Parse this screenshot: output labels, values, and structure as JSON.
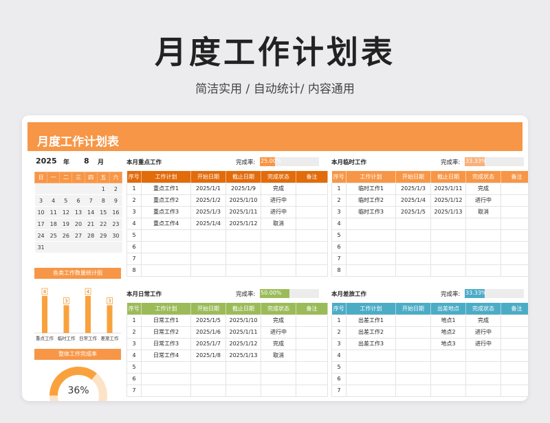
{
  "hero": {
    "title": "月度工作计划表",
    "subtitle": "简洁实用 / 自动统计/ 内容通用"
  },
  "banner": {
    "title": "月度工作计划表"
  },
  "date": {
    "year": "2025",
    "year_unit": "年",
    "month": "8",
    "month_unit": "月"
  },
  "calendar": {
    "weekdays": [
      "日",
      "一",
      "二",
      "三",
      "四",
      "五",
      "六"
    ],
    "weeks": [
      [
        "",
        "",
        "",
        "",
        "",
        "1",
        "2"
      ],
      [
        "3",
        "4",
        "5",
        "6",
        "7",
        "8",
        "9"
      ],
      [
        "10",
        "11",
        "12",
        "13",
        "14",
        "15",
        "16"
      ],
      [
        "17",
        "18",
        "19",
        "20",
        "21",
        "22",
        "23"
      ],
      [
        "24",
        "25",
        "26",
        "27",
        "28",
        "29",
        "30"
      ],
      [
        "31",
        "",
        "",
        "",
        "",
        "",
        ""
      ]
    ]
  },
  "stats": {
    "title": "各类工作数量统计图",
    "bars": [
      {
        "label": "重点工作",
        "value": 4
      },
      {
        "label": "临时工作",
        "value": 3
      },
      {
        "label": "日常工作",
        "value": 4
      },
      {
        "label": "差旅工作",
        "value": 3
      }
    ],
    "bar_color": "#f9a23d"
  },
  "overall": {
    "title": "整体工作完成率",
    "value": "36%",
    "fraction": 0.36
  },
  "rate_label": "完成率:",
  "sections": [
    {
      "key": "key",
      "title": "本月重点工作",
      "rate": "25.00%",
      "rate_fraction": 0.25,
      "color": "#e26b0a",
      "rate_color": "#f79646",
      "headers": [
        "序号",
        "工作计划",
        "开始日期",
        "截止日期",
        "完成状态",
        "备注"
      ],
      "rows": [
        [
          "1",
          "重点工作1",
          "2025/1/1",
          "2025/1/9",
          "完成",
          ""
        ],
        [
          "2",
          "重点工作2",
          "2025/1/2",
          "2025/1/10",
          "进行中",
          ""
        ],
        [
          "3",
          "重点工作3",
          "2025/1/3",
          "2025/1/11",
          "进行中",
          ""
        ],
        [
          "4",
          "重点工作4",
          "2025/1/4",
          "2025/1/12",
          "取消",
          ""
        ],
        [
          "5",
          "",
          "",
          "",
          "",
          ""
        ],
        [
          "6",
          "",
          "",
          "",
          "",
          ""
        ],
        [
          "7",
          "",
          "",
          "",
          "",
          ""
        ],
        [
          "8",
          "",
          "",
          "",
          "",
          ""
        ]
      ]
    },
    {
      "key": "temp",
      "title": "本月临时工作",
      "rate": "33.33%",
      "rate_fraction": 0.3333,
      "color": "#f79646",
      "rate_color": "#f9b07a",
      "headers": [
        "序号",
        "工作计划",
        "开始日期",
        "截止日期",
        "完成状态",
        "备注"
      ],
      "rows": [
        [
          "1",
          "临时工作1",
          "2025/1/3",
          "2025/1/11",
          "完成",
          ""
        ],
        [
          "2",
          "临时工作2",
          "2025/1/4",
          "2025/1/12",
          "进行中",
          ""
        ],
        [
          "3",
          "临时工作3",
          "2025/1/5",
          "2025/1/13",
          "取消",
          ""
        ],
        [
          "4",
          "",
          "",
          "",
          "",
          ""
        ],
        [
          "5",
          "",
          "",
          "",
          "",
          ""
        ],
        [
          "6",
          "",
          "",
          "",
          "",
          ""
        ],
        [
          "7",
          "",
          "",
          "",
          "",
          ""
        ],
        [
          "8",
          "",
          "",
          "",
          "",
          ""
        ]
      ]
    },
    {
      "key": "daily",
      "title": "本月日常工作",
      "rate": "50.00%",
      "rate_fraction": 0.5,
      "color": "#9bbb59",
      "rate_color": "#9bbb59",
      "headers": [
        "序号",
        "工作计划",
        "开始日期",
        "截止日期",
        "完成状态",
        "备注"
      ],
      "rows": [
        [
          "1",
          "日常工作1",
          "2025/1/5",
          "2025/1/10",
          "完成",
          ""
        ],
        [
          "2",
          "日常工作2",
          "2025/1/6",
          "2025/1/11",
          "进行中",
          ""
        ],
        [
          "3",
          "日常工作3",
          "2025/1/7",
          "2025/1/12",
          "完成",
          ""
        ],
        [
          "4",
          "日常工作4",
          "2025/1/8",
          "2025/1/13",
          "取消",
          ""
        ],
        [
          "5",
          "",
          "",
          "",
          "",
          ""
        ],
        [
          "6",
          "",
          "",
          "",
          "",
          ""
        ],
        [
          "7",
          "",
          "",
          "",
          "",
          ""
        ]
      ]
    },
    {
      "key": "travel",
      "title": "本月差旅工作",
      "rate": "33.33%",
      "rate_fraction": 0.3333,
      "color": "#4bacc6",
      "rate_color": "#4bacc6",
      "headers": [
        "序号",
        "工作计划",
        "开始日期",
        "出差地点",
        "完成状态",
        "备注"
      ],
      "rows": [
        [
          "1",
          "出差工作1",
          "",
          "地点1",
          "完成",
          ""
        ],
        [
          "2",
          "出差工作2",
          "",
          "地点2",
          "进行中",
          ""
        ],
        [
          "3",
          "出差工作3",
          "",
          "地点3",
          "进行中",
          ""
        ],
        [
          "4",
          "",
          "",
          "",
          "",
          ""
        ],
        [
          "5",
          "",
          "",
          "",
          "",
          ""
        ],
        [
          "6",
          "",
          "",
          "",
          "",
          ""
        ],
        [
          "7",
          "",
          "",
          "",
          "",
          ""
        ]
      ]
    }
  ]
}
